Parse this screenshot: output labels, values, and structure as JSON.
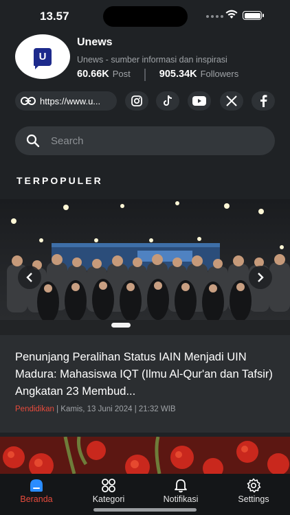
{
  "status": {
    "time": "13.57"
  },
  "profile": {
    "name": "Unews",
    "description": "Unews - sumber informasi dan inspirasi",
    "posts_count": "60.66K",
    "posts_label": "Post",
    "followers_count": "905.34K",
    "followers_label": "Followers",
    "logo_letter": "U"
  },
  "social": {
    "website": "https://www.u...",
    "icons": [
      "instagram-icon",
      "tiktok-icon",
      "youtube-icon",
      "x-icon",
      "facebook-icon"
    ]
  },
  "search": {
    "placeholder": "Search"
  },
  "section": {
    "title": "TERPOPULER"
  },
  "carousel": {
    "active_index": 0
  },
  "article": {
    "title": "Penunjang Peralihan Status IAIN Menjadi UIN Madura: Mahasiswa IQT (Ilmu Al-Qur'an dan Tafsir) Angkatan 23 Membud...",
    "category": "Pendidikan",
    "separator": " | ",
    "date": "Kamis, 13 Juni 2024 | 21:32 WIB"
  },
  "nav": {
    "items": [
      {
        "label": "Beranda",
        "icon": "home-icon",
        "active": true
      },
      {
        "label": "Kategori",
        "icon": "category-icon",
        "active": false
      },
      {
        "label": "Notifikasi",
        "icon": "bell-icon",
        "active": false
      },
      {
        "label": "Settings",
        "icon": "gear-icon",
        "active": false
      }
    ]
  },
  "colors": {
    "background": "#1f2225",
    "accent": "#e74b3c",
    "card": "#2b2e31"
  }
}
